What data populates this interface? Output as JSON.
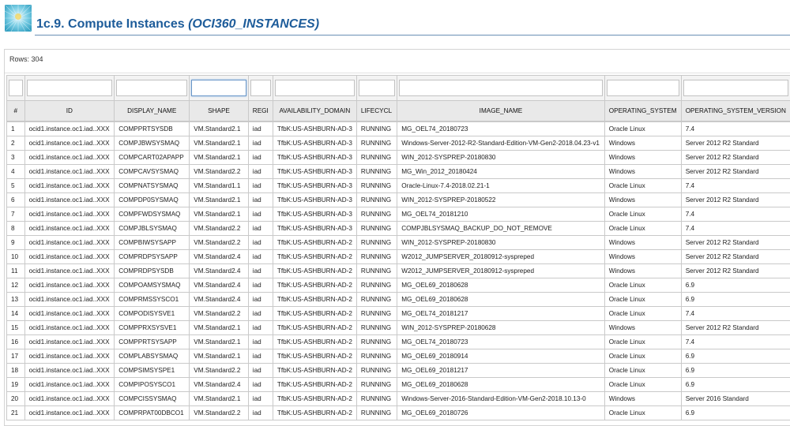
{
  "header": {
    "title": "1c.9. Compute Instances ",
    "subtitle": "(OCI360_INSTANCES)"
  },
  "report": {
    "rows_label": "Rows: 304"
  },
  "table": {
    "columns": [
      "#",
      "ID",
      "DISPLAY_NAME",
      "SHAPE",
      "REGI",
      "AVAILABILITY_DOMAIN",
      "LIFECYCL",
      "IMAGE_NAME",
      "OPERATING_SYSTEM",
      "OPERATING_SYSTEM_VERSION"
    ],
    "rows": [
      [
        "1",
        "ocid1.instance.oc1.iad..XXX",
        "COMPPRTSYSDB",
        "VM.Standard2.1",
        "iad",
        "TfbK:US-ASHBURN-AD-3",
        "RUNNING",
        "MG_OEL74_20180723",
        "Oracle Linux",
        "7.4"
      ],
      [
        "2",
        "ocid1.instance.oc1.iad..XXX",
        "COMPJBWSYSMAQ",
        "VM.Standard2.1",
        "iad",
        "TfbK:US-ASHBURN-AD-3",
        "RUNNING",
        "Windows-Server-2012-R2-Standard-Edition-VM-Gen2-2018.04.23-v1",
        "Windows",
        "Server 2012 R2 Standard"
      ],
      [
        "3",
        "ocid1.instance.oc1.iad..XXX",
        "COMPCART02APAPP",
        "VM.Standard2.1",
        "iad",
        "TfbK:US-ASHBURN-AD-3",
        "RUNNING",
        "WIN_2012-SYSPREP-20180830",
        "Windows",
        "Server 2012 R2 Standard"
      ],
      [
        "4",
        "ocid1.instance.oc1.iad..XXX",
        "COMPCAVSYSMAQ",
        "VM.Standard2.2",
        "iad",
        "TfbK:US-ASHBURN-AD-3",
        "RUNNING",
        "MG_Win_2012_20180424",
        "Windows",
        "Server 2012 R2 Standard"
      ],
      [
        "5",
        "ocid1.instance.oc1.iad..XXX",
        "COMPNATSYSMAQ",
        "VM.Standard1.1",
        "iad",
        "TfbK:US-ASHBURN-AD-3",
        "RUNNING",
        "Oracle-Linux-7.4-2018.02.21-1",
        "Oracle Linux",
        "7.4"
      ],
      [
        "6",
        "ocid1.instance.oc1.iad..XXX",
        "COMPDP0SYSMAQ",
        "VM.Standard2.1",
        "iad",
        "TfbK:US-ASHBURN-AD-3",
        "RUNNING",
        "WIN_2012-SYSPREP-20180522",
        "Windows",
        "Server 2012 R2 Standard"
      ],
      [
        "7",
        "ocid1.instance.oc1.iad..XXX",
        "COMPFWDSYSMAQ",
        "VM.Standard2.1",
        "iad",
        "TfbK:US-ASHBURN-AD-3",
        "RUNNING",
        "MG_OEL74_20181210",
        "Oracle Linux",
        "7.4"
      ],
      [
        "8",
        "ocid1.instance.oc1.iad..XXX",
        "COMPJBLSYSMAQ",
        "VM.Standard2.2",
        "iad",
        "TfbK:US-ASHBURN-AD-3",
        "RUNNING",
        "COMPJBLSYSMAQ_BACKUP_DO_NOT_REMOVE",
        "Oracle Linux",
        "7.4"
      ],
      [
        "9",
        "ocid1.instance.oc1.iad..XXX",
        "COMPBIWSYSAPP",
        "VM.Standard2.2",
        "iad",
        "TfbK:US-ASHBURN-AD-2",
        "RUNNING",
        "WIN_2012-SYSPREP-20180830",
        "Windows",
        "Server 2012 R2 Standard"
      ],
      [
        "10",
        "ocid1.instance.oc1.iad..XXX",
        "COMPRDPSYSAPP",
        "VM.Standard2.4",
        "iad",
        "TfbK:US-ASHBURN-AD-2",
        "RUNNING",
        "W2012_JUMPSERVER_20180912-syspreped",
        "Windows",
        "Server 2012 R2 Standard"
      ],
      [
        "11",
        "ocid1.instance.oc1.iad..XXX",
        "COMPRDPSYSDB",
        "VM.Standard2.4",
        "iad",
        "TfbK:US-ASHBURN-AD-2",
        "RUNNING",
        "W2012_JUMPSERVER_20180912-syspreped",
        "Windows",
        "Server 2012 R2 Standard"
      ],
      [
        "12",
        "ocid1.instance.oc1.iad..XXX",
        "COMPOAMSYSMAQ",
        "VM.Standard2.4",
        "iad",
        "TfbK:US-ASHBURN-AD-2",
        "RUNNING",
        "MG_OEL69_20180628",
        "Oracle Linux",
        "6.9"
      ],
      [
        "13",
        "ocid1.instance.oc1.iad..XXX",
        "COMPRMSSYSCO1",
        "VM.Standard2.4",
        "iad",
        "TfbK:US-ASHBURN-AD-2",
        "RUNNING",
        "MG_OEL69_20180628",
        "Oracle Linux",
        "6.9"
      ],
      [
        "14",
        "ocid1.instance.oc1.iad..XXX",
        "COMPODISYSVE1",
        "VM.Standard2.2",
        "iad",
        "TfbK:US-ASHBURN-AD-2",
        "RUNNING",
        "MG_OEL74_20181217",
        "Oracle Linux",
        "7.4"
      ],
      [
        "15",
        "ocid1.instance.oc1.iad..XXX",
        "COMPPRXSYSVE1",
        "VM.Standard2.1",
        "iad",
        "TfbK:US-ASHBURN-AD-2",
        "RUNNING",
        "WIN_2012-SYSPREP-20180628",
        "Windows",
        "Server 2012 R2 Standard"
      ],
      [
        "16",
        "ocid1.instance.oc1.iad..XXX",
        "COMPPRTSYSAPP",
        "VM.Standard2.1",
        "iad",
        "TfbK:US-ASHBURN-AD-2",
        "RUNNING",
        "MG_OEL74_20180723",
        "Oracle Linux",
        "7.4"
      ],
      [
        "17",
        "ocid1.instance.oc1.iad..XXX",
        "COMPLABSYSMAQ",
        "VM.Standard2.1",
        "iad",
        "TfbK:US-ASHBURN-AD-2",
        "RUNNING",
        "MG_OEL69_20180914",
        "Oracle Linux",
        "6.9"
      ],
      [
        "18",
        "ocid1.instance.oc1.iad..XXX",
        "COMPSIMSYSPE1",
        "VM.Standard2.2",
        "iad",
        "TfbK:US-ASHBURN-AD-2",
        "RUNNING",
        "MG_OEL69_20181217",
        "Oracle Linux",
        "6.9"
      ],
      [
        "19",
        "ocid1.instance.oc1.iad..XXX",
        "COMPIPOSYSCO1",
        "VM.Standard2.4",
        "iad",
        "TfbK:US-ASHBURN-AD-2",
        "RUNNING",
        "MG_OEL69_20180628",
        "Oracle Linux",
        "6.9"
      ],
      [
        "20",
        "ocid1.instance.oc1.iad..XXX",
        "COMPCISSYSMAQ",
        "VM.Standard2.1",
        "iad",
        "TfbK:US-ASHBURN-AD-2",
        "RUNNING",
        "Windows-Server-2016-Standard-Edition-VM-Gen2-2018.10.13-0",
        "Windows",
        "Server 2016 Standard"
      ],
      [
        "21",
        "ocid1.instance.oc1.iad..XXX",
        "COMPRPAT00DBCO1",
        "VM.Standard2.2",
        "iad",
        "TfbK:US-ASHBURN-AD-2",
        "RUNNING",
        "MG_OEL69_20180726",
        "Oracle Linux",
        "6.9"
      ]
    ]
  }
}
